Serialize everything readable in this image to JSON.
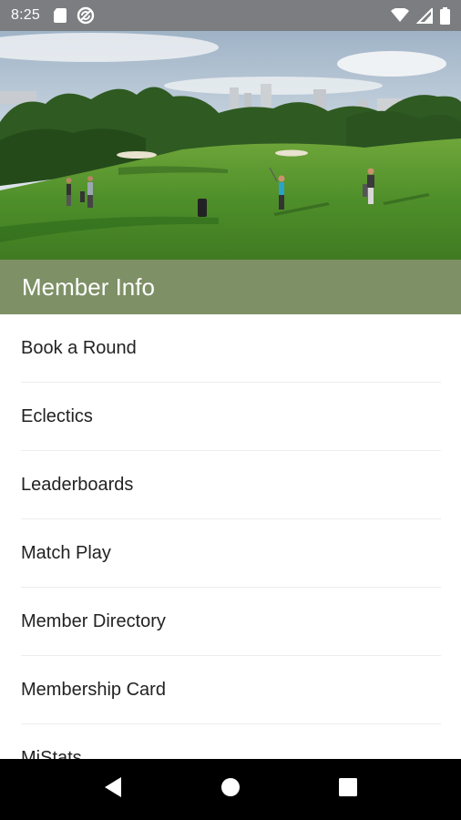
{
  "status_bar": {
    "time": "8:25",
    "left_icons": [
      "sd-card-icon",
      "sync-icon"
    ],
    "right_icons": [
      "wifi-icon",
      "signal-icon",
      "battery-icon"
    ]
  },
  "hero": {
    "image": "golf-course-photo"
  },
  "section": {
    "title": "Member Info"
  },
  "menu": {
    "items": [
      {
        "label": "Book a Round"
      },
      {
        "label": "Eclectics"
      },
      {
        "label": "Leaderboards"
      },
      {
        "label": "Match Play"
      },
      {
        "label": "Member Directory"
      },
      {
        "label": "Membership Card"
      },
      {
        "label": "MiStats"
      }
    ]
  },
  "nav_bar": {
    "buttons": [
      "back-icon",
      "home-icon",
      "recents-icon"
    ]
  },
  "colors": {
    "status_bar": "#7b7d80",
    "header": "#7e9066",
    "nav_bar": "#000000"
  }
}
